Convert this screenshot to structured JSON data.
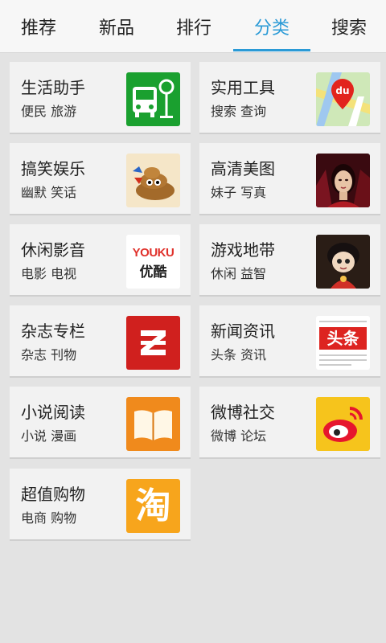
{
  "tabs": [
    {
      "label": "推荐",
      "active": false
    },
    {
      "label": "新品",
      "active": false
    },
    {
      "label": "排行",
      "active": false
    },
    {
      "label": "分类",
      "active": true
    },
    {
      "label": "搜索",
      "active": false
    }
  ],
  "colors": {
    "accent": "#2a9ad6",
    "background": "#e3e3e3",
    "card": "#f2f2f2"
  },
  "categories": [
    {
      "title": "生活助手",
      "subtitle": "便民 旅游",
      "icon": "bus-stop-icon"
    },
    {
      "title": "实用工具",
      "subtitle": "搜索 查询",
      "icon": "baidu-map-icon"
    },
    {
      "title": "搞笑娱乐",
      "subtitle": "幽默 笑话",
      "icon": "funny-cartoon-icon"
    },
    {
      "title": "高清美图",
      "subtitle": "妹子 写真",
      "icon": "portrait-photo-icon"
    },
    {
      "title": "休闲影音",
      "subtitle": "电影 电视",
      "icon": "youku-logo-icon",
      "logo_text_top": "YOUKU",
      "logo_text_bottom": "优酷"
    },
    {
      "title": "游戏地带",
      "subtitle": "休闲 益智",
      "icon": "cartoon-character-icon"
    },
    {
      "title": "杂志专栏",
      "subtitle": "杂志 刊物",
      "icon": "zaker-logo-icon"
    },
    {
      "title": "新闻资讯",
      "subtitle": "头条 资讯",
      "icon": "toutiao-logo-icon",
      "logo_text": "头条"
    },
    {
      "title": "小说阅读",
      "subtitle": "小说 漫画",
      "icon": "open-book-icon"
    },
    {
      "title": "微博社交",
      "subtitle": "微博 论坛",
      "icon": "weibo-logo-icon"
    },
    {
      "title": "超值购物",
      "subtitle": "电商 购物",
      "icon": "taobao-logo-icon",
      "logo_text": "淘"
    }
  ]
}
